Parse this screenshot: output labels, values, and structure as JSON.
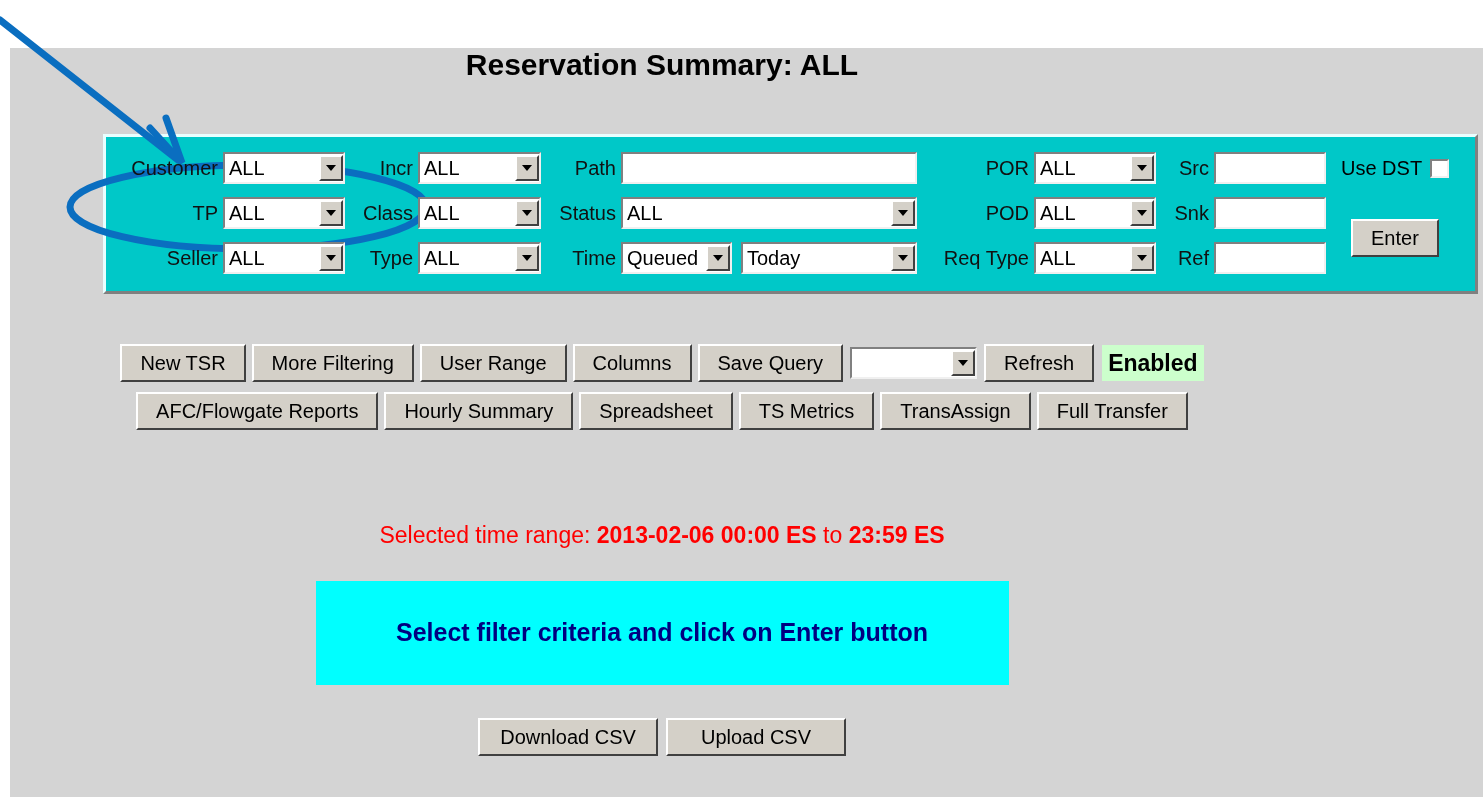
{
  "title": "Reservation Summary: ALL",
  "filters": {
    "rows": [
      [
        {
          "label": "Customer",
          "kind": "select",
          "value": "ALL"
        },
        {
          "label": "Incr",
          "kind": "select",
          "value": "ALL"
        },
        {
          "label": "Path",
          "kind": "text"
        },
        {
          "label": "POR",
          "kind": "select",
          "value": "ALL"
        },
        {
          "label": "Src",
          "kind": "text"
        },
        {
          "label": "Use DST",
          "kind": "checkbox",
          "checked": false
        }
      ],
      [
        {
          "label": "TP",
          "kind": "select",
          "value": "ALL"
        },
        {
          "label": "Class",
          "kind": "select",
          "value": "ALL"
        },
        {
          "label": "Status",
          "kind": "select",
          "value": "ALL"
        },
        {
          "label": "POD",
          "kind": "select",
          "value": "ALL"
        },
        {
          "label": "Snk",
          "kind": "text"
        },
        {
          "label": "Enter",
          "kind": "button"
        }
      ],
      [
        {
          "label": "Seller",
          "kind": "select",
          "value": "ALL"
        },
        {
          "label": "Type",
          "kind": "select",
          "value": "ALL"
        },
        {
          "label": "Time",
          "kind": "select_pair",
          "values": [
            "Queued",
            "Today"
          ]
        },
        {
          "label": "Req Type",
          "kind": "select",
          "value": "ALL"
        },
        {
          "label": "Ref",
          "kind": "text"
        }
      ]
    ]
  },
  "toolbar_rows": [
    [
      {
        "kind": "button",
        "label": "New TSR"
      },
      {
        "kind": "button",
        "label": "More Filtering"
      },
      {
        "kind": "button",
        "label": "User Range"
      },
      {
        "kind": "button",
        "label": "Columns"
      },
      {
        "kind": "button",
        "label": "Save Query"
      },
      {
        "kind": "select"
      },
      {
        "kind": "button",
        "label": "Refresh"
      },
      {
        "kind": "badge",
        "label": "Enabled"
      }
    ],
    [
      {
        "kind": "button",
        "label": "AFC/Flowgate Reports"
      },
      {
        "kind": "button",
        "label": "Hourly Summary"
      },
      {
        "kind": "button",
        "label": "Spreadsheet"
      },
      {
        "kind": "button",
        "label": "TS Metrics"
      },
      {
        "kind": "button",
        "label": "TransAssign"
      },
      {
        "kind": "button",
        "label": "Full Transfer"
      }
    ]
  ],
  "time_range": "Selected time range: **2013-02-06 00:00 ES** to **23:59 ES**",
  "message": "Select filter criteria and click on Enter button",
  "bottom_buttons": [
    "Download CSV",
    "Upload CSV"
  ]
}
